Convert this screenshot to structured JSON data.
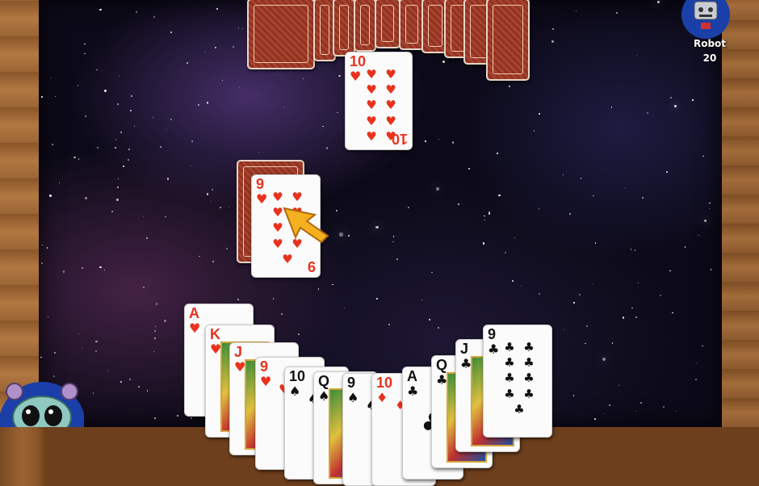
{
  "opponent": {
    "name": "Robot",
    "score": "20"
  },
  "pile_card": {
    "rank": "10",
    "suit": "♥"
  },
  "played_card": {
    "rank": "9",
    "suit": "♥"
  },
  "hand": [
    {
      "rank": "A",
      "suit": "♥",
      "color": "red"
    },
    {
      "rank": "K",
      "suit": "♥",
      "color": "red"
    },
    {
      "rank": "J",
      "suit": "♥",
      "color": "red"
    },
    {
      "rank": "9",
      "suit": "♥",
      "color": "red"
    },
    {
      "rank": "10",
      "suit": "♠",
      "color": "black"
    },
    {
      "rank": "Q",
      "suit": "♠",
      "color": "black"
    },
    {
      "rank": "9",
      "suit": "♠",
      "color": "black"
    },
    {
      "rank": "10",
      "suit": "♦",
      "color": "red"
    },
    {
      "rank": "A",
      "suit": "♣",
      "color": "black"
    },
    {
      "rank": "Q",
      "suit": "♣",
      "color": "black"
    },
    {
      "rank": "J",
      "suit": "♣",
      "color": "black"
    },
    {
      "rank": "9",
      "suit": "♣",
      "color": "black"
    }
  ],
  "colors": {
    "red_suit": "#e8321e",
    "card_back": "#a8422e",
    "cursor": "#f5b020"
  }
}
